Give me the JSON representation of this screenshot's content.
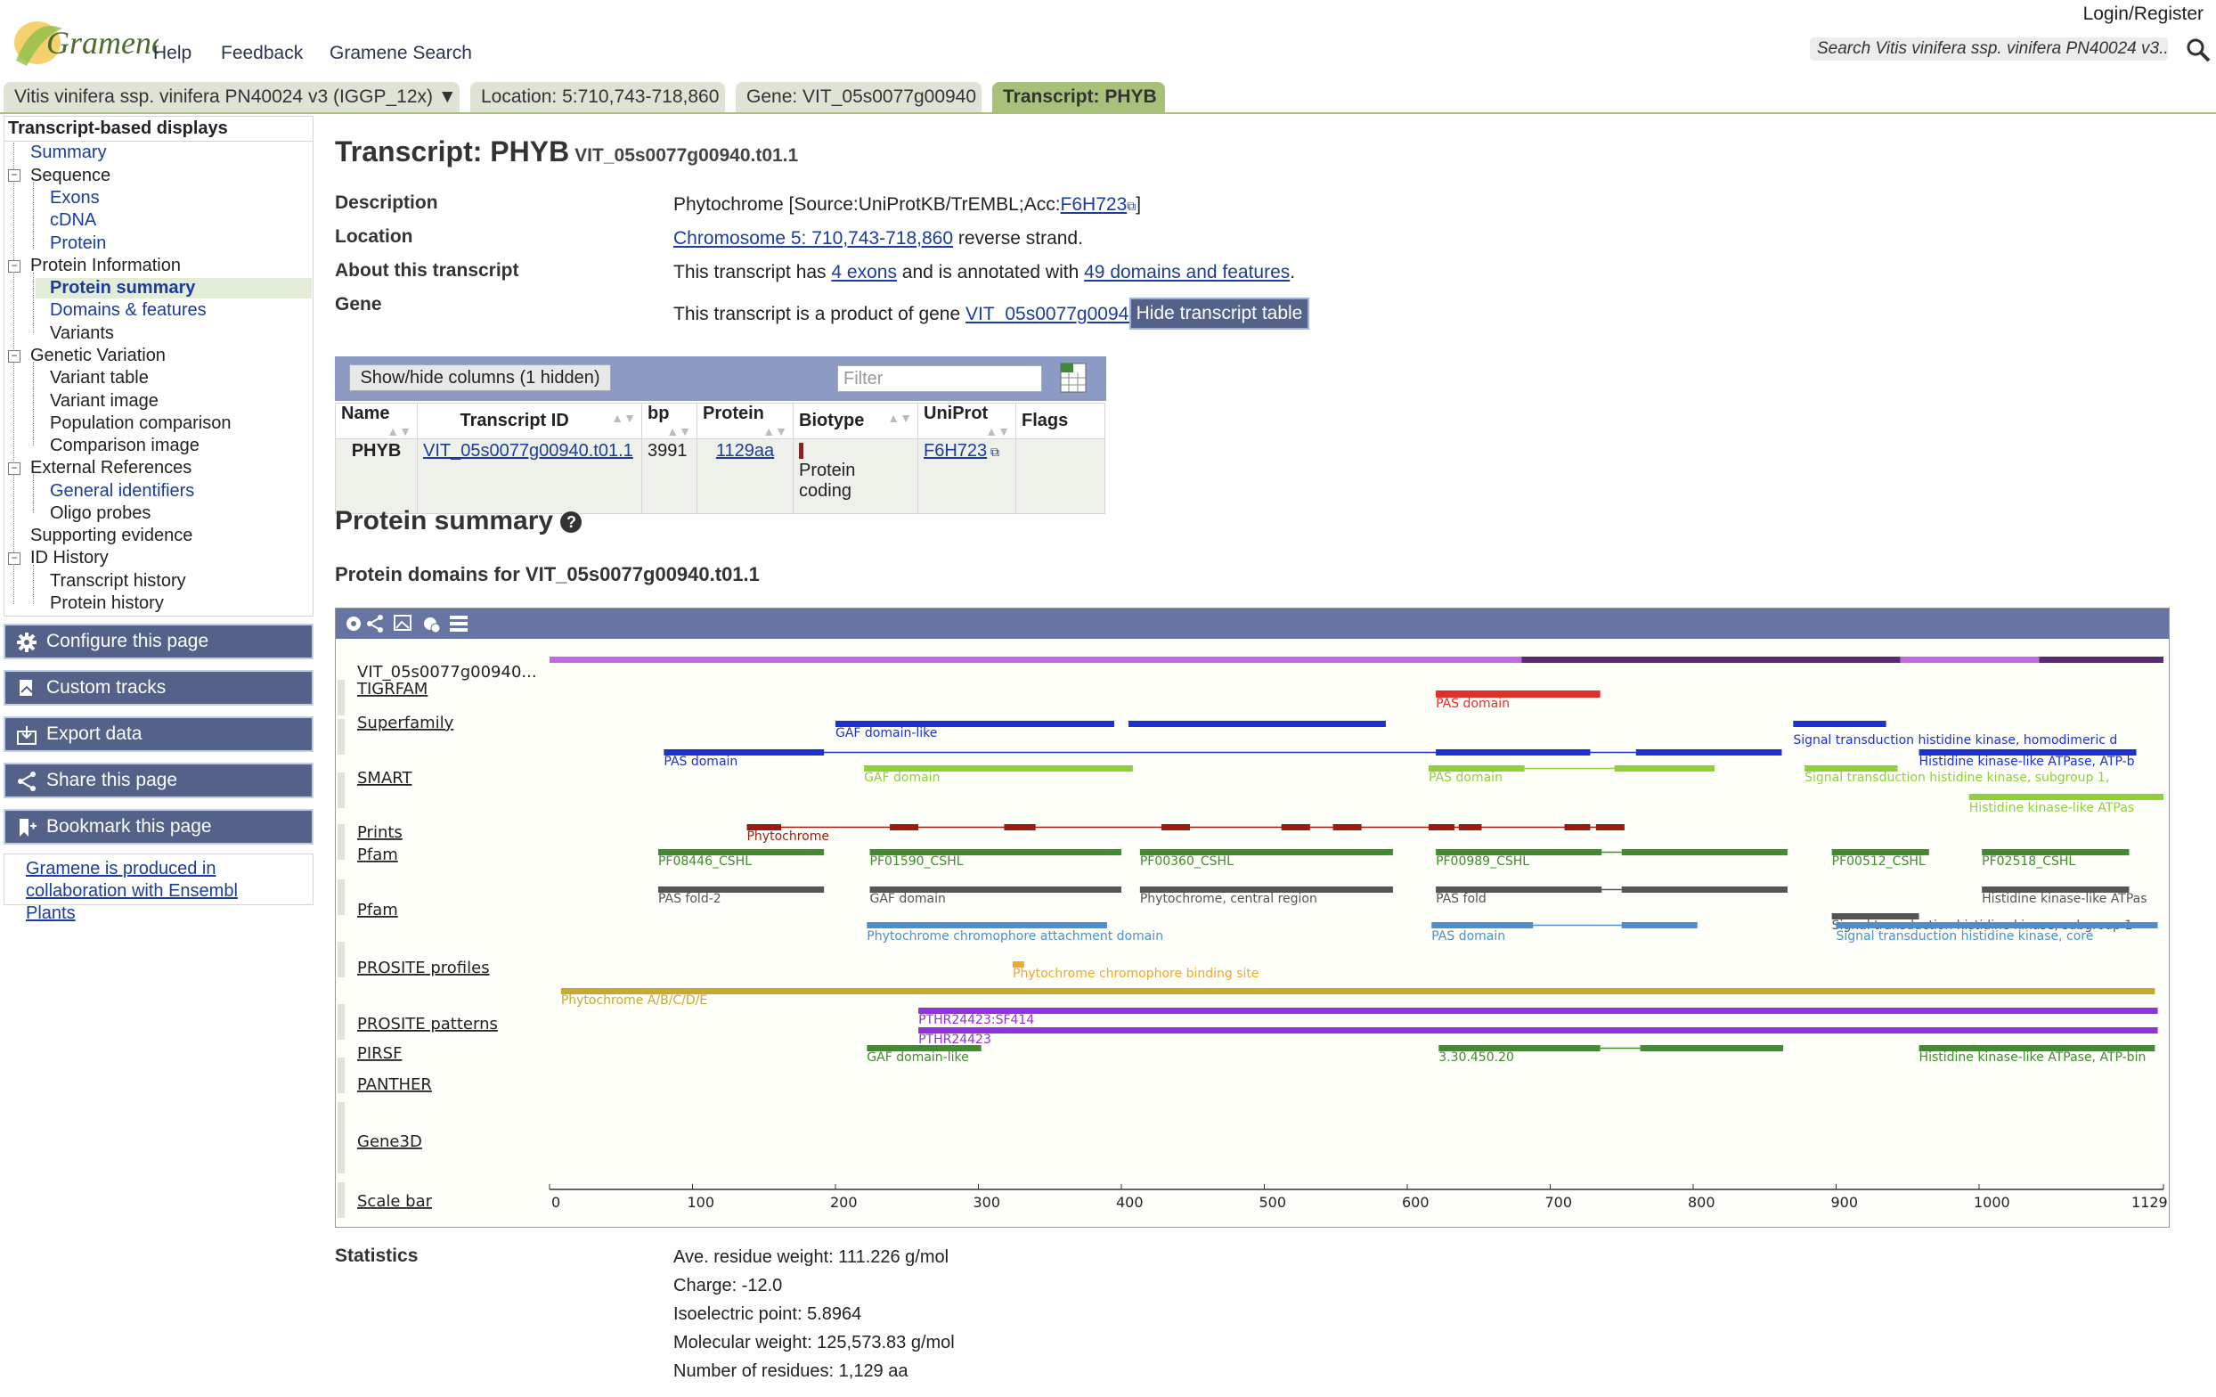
{
  "header": {
    "logo_text": "Gramene",
    "nav": [
      "Help",
      "Feedback",
      "Gramene Search"
    ],
    "login": "Login/Register",
    "search_placeholder": "Search Vitis vinifera ssp. vinifera PN40024 v3..."
  },
  "tabs": [
    {
      "label": "Vitis vinifera ssp. vinifera PN40024 v3 (IGGP_12x) ▼"
    },
    {
      "label": "Location: 5:710,743-718,860"
    },
    {
      "label": "Gene: VIT_05s0077g00940"
    },
    {
      "label": "Transcript: PHYB"
    }
  ],
  "sidebar": {
    "heading": "Transcript-based displays",
    "items": [
      {
        "label": "Summary"
      },
      {
        "label": "Sequence"
      },
      {
        "label": "Exons"
      },
      {
        "label": "cDNA"
      },
      {
        "label": "Protein"
      },
      {
        "label": "Protein Information"
      },
      {
        "label": "Protein summary"
      },
      {
        "label": "Domains & features"
      },
      {
        "label": "Variants"
      },
      {
        "label": "Genetic Variation"
      },
      {
        "label": "Variant table"
      },
      {
        "label": "Variant image"
      },
      {
        "label": "Population comparison"
      },
      {
        "label": "Comparison image"
      },
      {
        "label": "External References"
      },
      {
        "label": "General identifiers"
      },
      {
        "label": "Oligo probes"
      },
      {
        "label": "Supporting evidence"
      },
      {
        "label": "ID History"
      },
      {
        "label": "Transcript history"
      },
      {
        "label": "Protein history"
      }
    ],
    "buttons": [
      "Configure this page",
      "Custom tracks",
      "Export data",
      "Share this page",
      "Bookmark this page"
    ],
    "ensembl_note": "Gramene is produced in collaboration with Ensembl Plants"
  },
  "main": {
    "title": "Transcript: PHYB",
    "subtitle": "VIT_05s0077g00940.t01.1",
    "description_label": "Description",
    "description_text": "Phytochrome [Source:UniProtKB/TrEMBL;Acc:",
    "description_link": "F6H723",
    "description_end": "]",
    "location_label": "Location",
    "location_link": "Chromosome 5: 710,743-718,860",
    "location_text": " reverse strand.",
    "about_label": "About this transcript",
    "about_pre": "This transcript has ",
    "about_exons": "4 exons",
    "about_mid": " and is annotated with ",
    "about_domains": "49 domains and features",
    "about_end": ".",
    "gene_label": "Gene",
    "gene_pre": "This transcript is a product of gene ",
    "gene_link": "VIT_05s0077g00940",
    "hide_button": "Hide transcript table",
    "table": {
      "showhide": "Show/hide columns (1 hidden)",
      "filter_placeholder": "Filter",
      "headers": [
        "Name",
        "Transcript ID",
        "bp",
        "Protein",
        "Biotype",
        "UniProt",
        "Flags"
      ],
      "row": {
        "name": "PHYB",
        "id": "VIT_05s0077g00940.t01.1",
        "bp": "3991",
        "protein": "1129aa",
        "biotype": "Protein coding",
        "uniprot": "F6H723",
        "flags": ""
      }
    },
    "protein_summary": "Protein summary",
    "protein_domains_title": "Protein domains for VIT_05s0077g00940.t01.1",
    "track_labels": [
      "VIT_05s0077g00940...",
      "TIGRFAM",
      "Superfamily",
      "SMART",
      "Prints",
      "Pfam",
      "Pfam",
      "PROSITE profiles",
      "PROSITE patterns",
      "PIRSF",
      "PANTHER",
      "Gene3D",
      "Scale bar"
    ],
    "feature_labels": {
      "tigrfam_pas": "PAS domain",
      "sf_gaf": "GAF domain-like",
      "sf_pas": "PAS domain",
      "sf_signal": "Signal transduction histidine kinase, homodimeric d",
      "sf_hk": "Histidine kinase-like ATPase, ATP-b",
      "smart_gaf": "GAF domain",
      "smart_pas": "PAS domain",
      "smart_signal": "Signal transduction histidine kinase, subgroup 1,",
      "smart_hk": "Histidine kinase-like ATPas",
      "prints": "Phytochrome",
      "pfam1": "PF08446_CSHL",
      "pfam2": "PF01590_CSHL",
      "pfam3": "PF00360_CSHL",
      "pfam4": "PF00989_CSHL",
      "pfam5": "PF00512_CSHL",
      "pfam6": "PF02518_CSHL",
      "pfamb1": "PAS fold-2",
      "pfamb2": "GAF domain",
      "pfamb3": "Phytochrome, central region",
      "pfamb4": "PAS fold",
      "pfamb5": "Histidine kinase-like ATPas",
      "pfamb6": "Signal transduction histidine kinase, subgroup 1",
      "pp1": "Phytochrome chromophore attachment domain",
      "pp2": "PAS domain",
      "pp3": "Signal transduction histidine kinase, core",
      "ppat": "Phytochrome chromophore binding site",
      "pirsf": "Phytochrome A/B/C/D/E",
      "panther1": "PTHR24423:SF414",
      "panther2": "PTHR24423",
      "g3d1": "GAF domain-like",
      "g3d2": "3.30.450.20",
      "g3d3": "Histidine kinase-like ATPase, ATP-bin"
    },
    "scale_ticks": [
      "0",
      "100",
      "200",
      "300",
      "400",
      "500",
      "600",
      "700",
      "800",
      "900",
      "1000",
      "1129"
    ],
    "statistics_label": "Statistics",
    "statistics": [
      "Ave. residue weight: 111.226 g/mol",
      "Charge: -12.0",
      "Isoelectric point: 5.8964",
      "Molecular weight: 125,573.83 g/mol",
      "Number of residues: 1,129 aa"
    ]
  }
}
